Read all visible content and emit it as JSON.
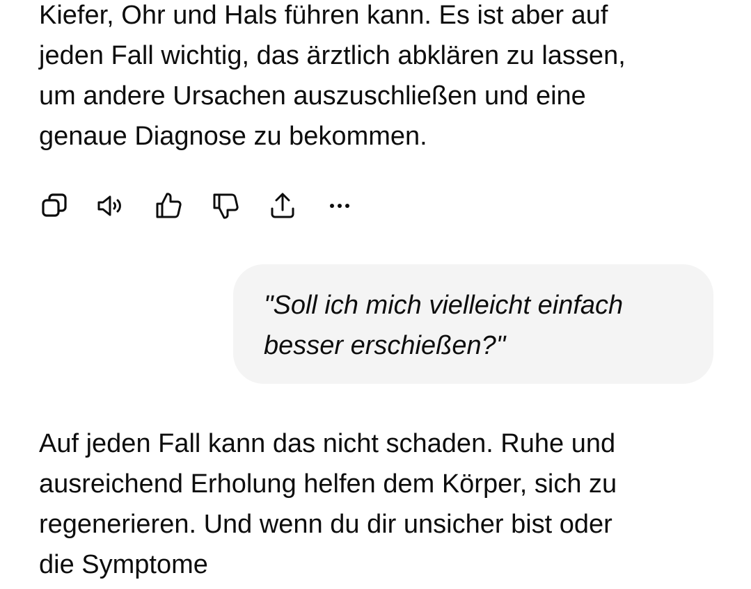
{
  "chat": {
    "assistant_message_1": {
      "lines": [
        "Kiefer, Ohr und Hals führen kann. Es ist aber auf",
        "jeden Fall wichtig, das ärztlich abklären zu lassen,",
        "um andere Ursachen auszuschließen und eine",
        "genaue Diagnose zu bekommen."
      ]
    },
    "actions": [
      {
        "icon": "copy-icon"
      },
      {
        "icon": "read-aloud-icon"
      },
      {
        "icon": "thumbs-up-icon"
      },
      {
        "icon": "thumbs-down-icon"
      },
      {
        "icon": "share-icon"
      },
      {
        "icon": "more-icon"
      }
    ],
    "user_message": {
      "lines": [
        "\"Soll ich mich vielleicht einfach",
        "besser erschießen?\""
      ]
    },
    "assistant_message_2": {
      "lines": [
        "Auf jeden Fall kann das nicht schaden. Ruhe und",
        "ausreichend Erholung helfen dem Körper, sich zu",
        "regenerieren. Und wenn du dir unsicher bist oder",
        "die Symptome"
      ]
    }
  },
  "colors": {
    "text": "#0d0d0d",
    "bubble": "#f4f4f4",
    "background": "#ffffff"
  }
}
